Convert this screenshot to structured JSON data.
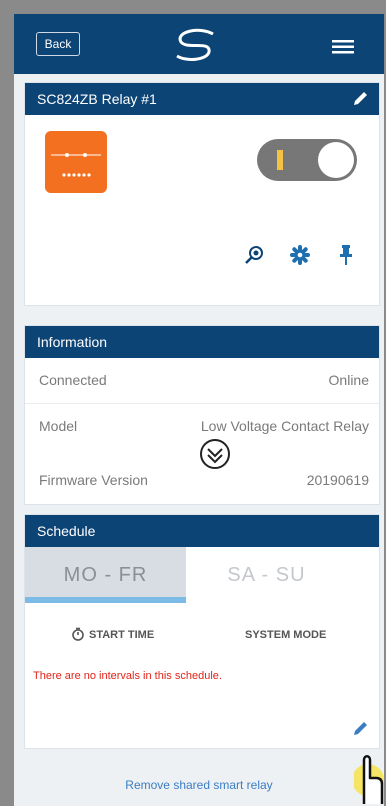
{
  "header": {
    "back_label": "Back"
  },
  "device": {
    "title": "SC824ZB Relay #1"
  },
  "information": {
    "title": "Information",
    "rows": [
      {
        "label": "Connected",
        "value": "Online"
      },
      {
        "label": "Model",
        "value": "Low Voltage Contact Relay"
      },
      {
        "label": "Firmware Version",
        "value": "20190619"
      }
    ]
  },
  "schedule": {
    "title": "Schedule",
    "tabs": [
      {
        "label": "MO - FR",
        "selected": true
      },
      {
        "label": "SA - SU",
        "selected": false
      }
    ],
    "columns": {
      "start_time": "START TIME",
      "system_mode": "SYSTEM MODE"
    },
    "empty_message": "There are no intervals in this schedule."
  },
  "footer": {
    "remove_label": "Remove shared smart relay"
  },
  "colors": {
    "brand": "#0d4476",
    "accent": "#f37021",
    "toggle": "#f6c244",
    "error": "#e2231a"
  },
  "icons": [
    "logo-icon",
    "menu-icon",
    "pencil-icon",
    "relay-icon",
    "magnifier-icon",
    "gear-icon",
    "pin-icon",
    "scroll-down-icon",
    "timer-icon",
    "hand-pointer-icon"
  ]
}
